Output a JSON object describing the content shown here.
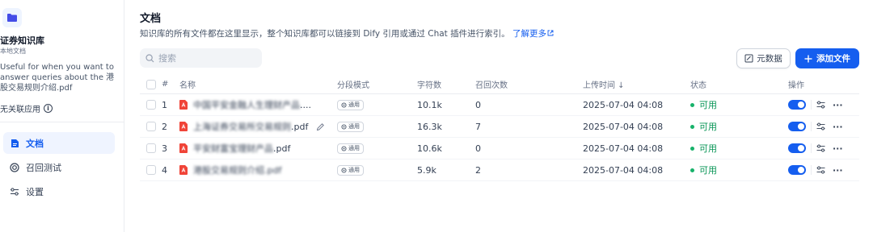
{
  "sidebar": {
    "kb_name": "证券知识库",
    "kb_type": "本地文档",
    "kb_description": "Useful for when you want to answer queries about the 港股交易规则介绍.pdf",
    "kb_apps": "无关联应用",
    "nav": [
      {
        "label": "文档",
        "icon": "document-icon",
        "active": true
      },
      {
        "label": "召回测试",
        "icon": "target-icon",
        "active": false
      },
      {
        "label": "设置",
        "icon": "settings-icon",
        "active": false
      }
    ]
  },
  "header": {
    "title": "文档",
    "subtitle": "知识库的所有文件都在这里显示，整个知识库都可以链接到 Dify 引用或通过 Chat 插件进行索引。",
    "learn_more": "了解更多"
  },
  "toolbar": {
    "search_placeholder": "搜索",
    "metadata_label": "元数据",
    "add_file_label": "添加文件"
  },
  "table": {
    "columns": {
      "index": "#",
      "name": "名称",
      "mode": "分段模式",
      "chars": "字符数",
      "hits": "召回次数",
      "upload_time": "上传时间 ↓",
      "status": "状态",
      "actions": "操作"
    },
    "rows": [
      {
        "index": "1",
        "name": "中国平安金融人生理财产品",
        "name_tail": "....",
        "mode": "通用",
        "chars": "10.1k",
        "hits": "0",
        "upload_time": "2025-07-04 04:08",
        "status": "可用",
        "enabled": true
      },
      {
        "index": "2",
        "name": "上海证券交易所交易规则",
        "name_tail": ".pdf",
        "mode": "通用",
        "chars": "16.3k",
        "hits": "7",
        "upload_time": "2025-07-04 04:08",
        "status": "可用",
        "enabled": true
      },
      {
        "index": "3",
        "name": "平安财富宝理财产品",
        "name_tail": ".pdf",
        "mode": "通用",
        "chars": "10.6k",
        "hits": "0",
        "upload_time": "2025-07-04 04:08",
        "status": "可用",
        "enabled": true
      },
      {
        "index": "4",
        "name": "港股交易规则介绍.pdf",
        "name_tail": "",
        "mode": "通用",
        "chars": "5.9k",
        "hits": "2",
        "upload_time": "2025-07-04 04:08",
        "status": "可用",
        "enabled": true
      }
    ]
  },
  "colors": {
    "accent": "#155eef",
    "status_green": "#17b26a",
    "pdf_red": "#f04438"
  }
}
